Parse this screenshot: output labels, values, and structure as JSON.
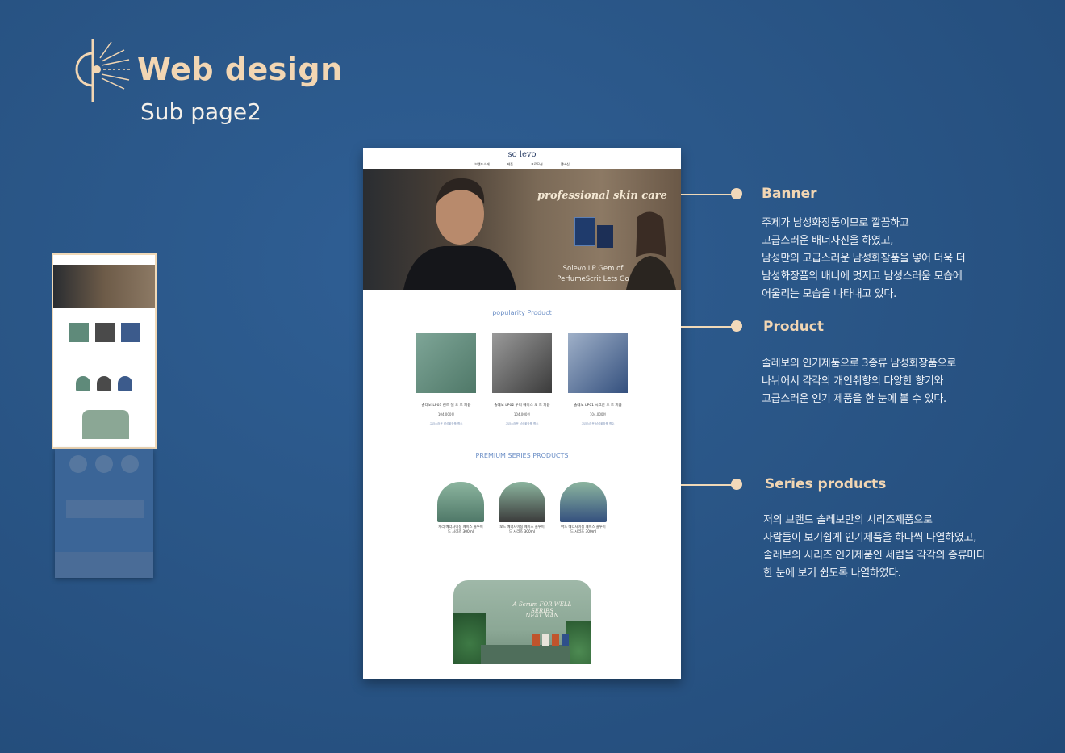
{
  "header": {
    "title": "Web design",
    "subtitle": "Sub page2"
  },
  "mockup": {
    "logo": "so levo",
    "nav": [
      "브랜드소개",
      "제품",
      "프로모션",
      "멤버십"
    ],
    "banner": {
      "script": "professional skin care",
      "caption_line1": "Solevo LP Gem of",
      "caption_line2": "PerfumeScrit Lets Go"
    },
    "popular": {
      "title": "popularity Product",
      "items": [
        {
          "name": "솔레보 LP03 린트 젤 오 드 퍼퓸",
          "price": "104,000원",
          "desc": "고급스러운 남성화장품 향수",
          "color": "#5f8a7a"
        },
        {
          "name": "솔레보 LP02 우디 메이스 오 드 퍼퓸",
          "price": "104,000원",
          "desc": "고급스러운 남성화장품 향수",
          "color": "#4a4a4a"
        },
        {
          "name": "솔레보 LP01 시크한 오 드 퍼퓸",
          "price": "104,000원",
          "desc": "고급스러운 남성화장품 향수",
          "color": "#3c5b8c"
        }
      ]
    },
    "premium": {
      "title": "PREMIUM SERIES PRODUCTS",
      "items": [
        {
          "name": "캐리 베너자이징 페이스 플루이드 시리즈 300ml",
          "color": "#5f8a7a"
        },
        {
          "name": "보드 베너자이징 페이스 플루이드 시리즈 300ml",
          "color": "#4a4a4a"
        },
        {
          "name": "아드 베너자이징 페이스 플루이드 시리즈 300ml",
          "color": "#3c5b8c"
        }
      ]
    },
    "promo": {
      "line1": "A Serum  FOR WELL SERIES",
      "line2": "NEAT MAN"
    }
  },
  "annotations": {
    "banner": {
      "title": "Banner",
      "lines": [
        "주제가 남성화장품이므로 깔끔하고",
        "고급스러운 배너사진을 하였고,",
        "남성만의 고급스러운 남성화잠품을 넣어 더욱 더",
        "남성화장품의 배너에 멋지고 남성스러움 모습에",
        "어울리는 모습을 나타내고 있다."
      ]
    },
    "product": {
      "title": "Product",
      "lines": [
        "솔레보의 인기제품으로 3종류 남성화장품으로",
        "나뉘어서 각각의 개인취향의 다양한 향기와",
        "고급스러운 인기 제품을 한 눈에 볼 수 있다."
      ]
    },
    "series": {
      "title": "Series products",
      "lines": [
        "저의 브랜드 솔레보만의 시리즈제품으로",
        "사람들이 보기쉽게 인기제품을 하나씩 나열하였고,",
        "솔레보의 시리즈 인기제품인 세럼을 각각의 종류마다",
        "한 눈에 보기 쉽도록 나열하였다."
      ]
    }
  },
  "colors": {
    "background": "#2a5687",
    "accent": "#f2d6b3",
    "title_text": "#f4f0ea"
  }
}
